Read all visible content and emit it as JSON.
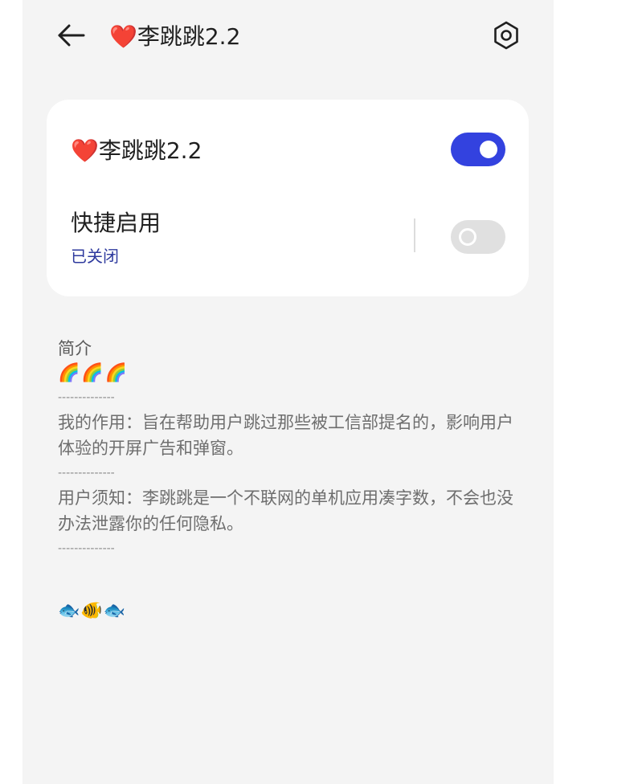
{
  "header": {
    "title": "❤️李跳跳2.2",
    "back_icon": "arrow-left-icon",
    "settings_icon": "hexagon-gear-icon"
  },
  "card": {
    "app_toggle": {
      "label": "❤️李跳跳2.2",
      "state": "on"
    },
    "quick_enable": {
      "label": "快捷启用",
      "status": "已关闭",
      "state": "off"
    }
  },
  "description": {
    "heading": "简介",
    "rainbows": "🌈🌈🌈",
    "separator": "--------------",
    "paragraph1": "我的作用：旨在帮助用户跳过那些被工信部提名的，影响用户体验的开屏广告和弹窗。",
    "paragraph2": "用户须知：李跳跳是一个不联网的单机应用凑字数，不会也没办法泄露你的任何隐私。",
    "fish": "🐟🐠🐟"
  },
  "colors": {
    "accent": "#3342df",
    "status_text": "#2e3a9e",
    "background": "#f4f4f4"
  }
}
